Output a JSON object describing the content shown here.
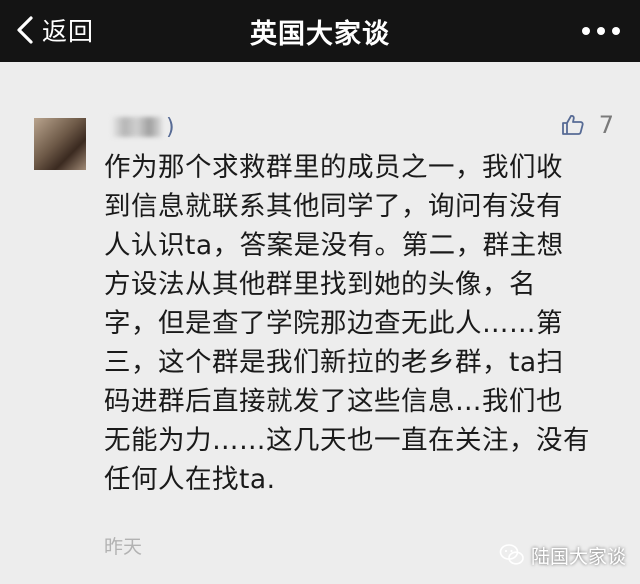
{
  "nav": {
    "back_label": "返回",
    "title": "英国大家谈"
  },
  "comment": {
    "username_suffix": ")",
    "like_count": "7",
    "text": "作为那个求救群里的成员之一，我们收\n到信息就联系其他同学了，询问有没有\n人认识ta，答案是没有。第二，群主想\n方设法从其他群里找到她的头像，名\n字，但是查了学院那边查无此人……第\n三，这个群是我们新拉的老乡群，ta扫\n码进群后直接就发了这些信息…我们也\n无能为力……这几天也一直在关注，没有\n任何人在找ta.",
    "time": "昨天"
  },
  "watermark": {
    "text": "陆国大家谈"
  },
  "icons": {
    "back": "chevron-left-icon",
    "more": "more-dots-icon",
    "like": "thumbs-up-icon",
    "watermark": "wechat-icon"
  },
  "colors": {
    "nav_bg": "#141414",
    "page_bg": "#ededed",
    "link_blue": "#576b95"
  }
}
